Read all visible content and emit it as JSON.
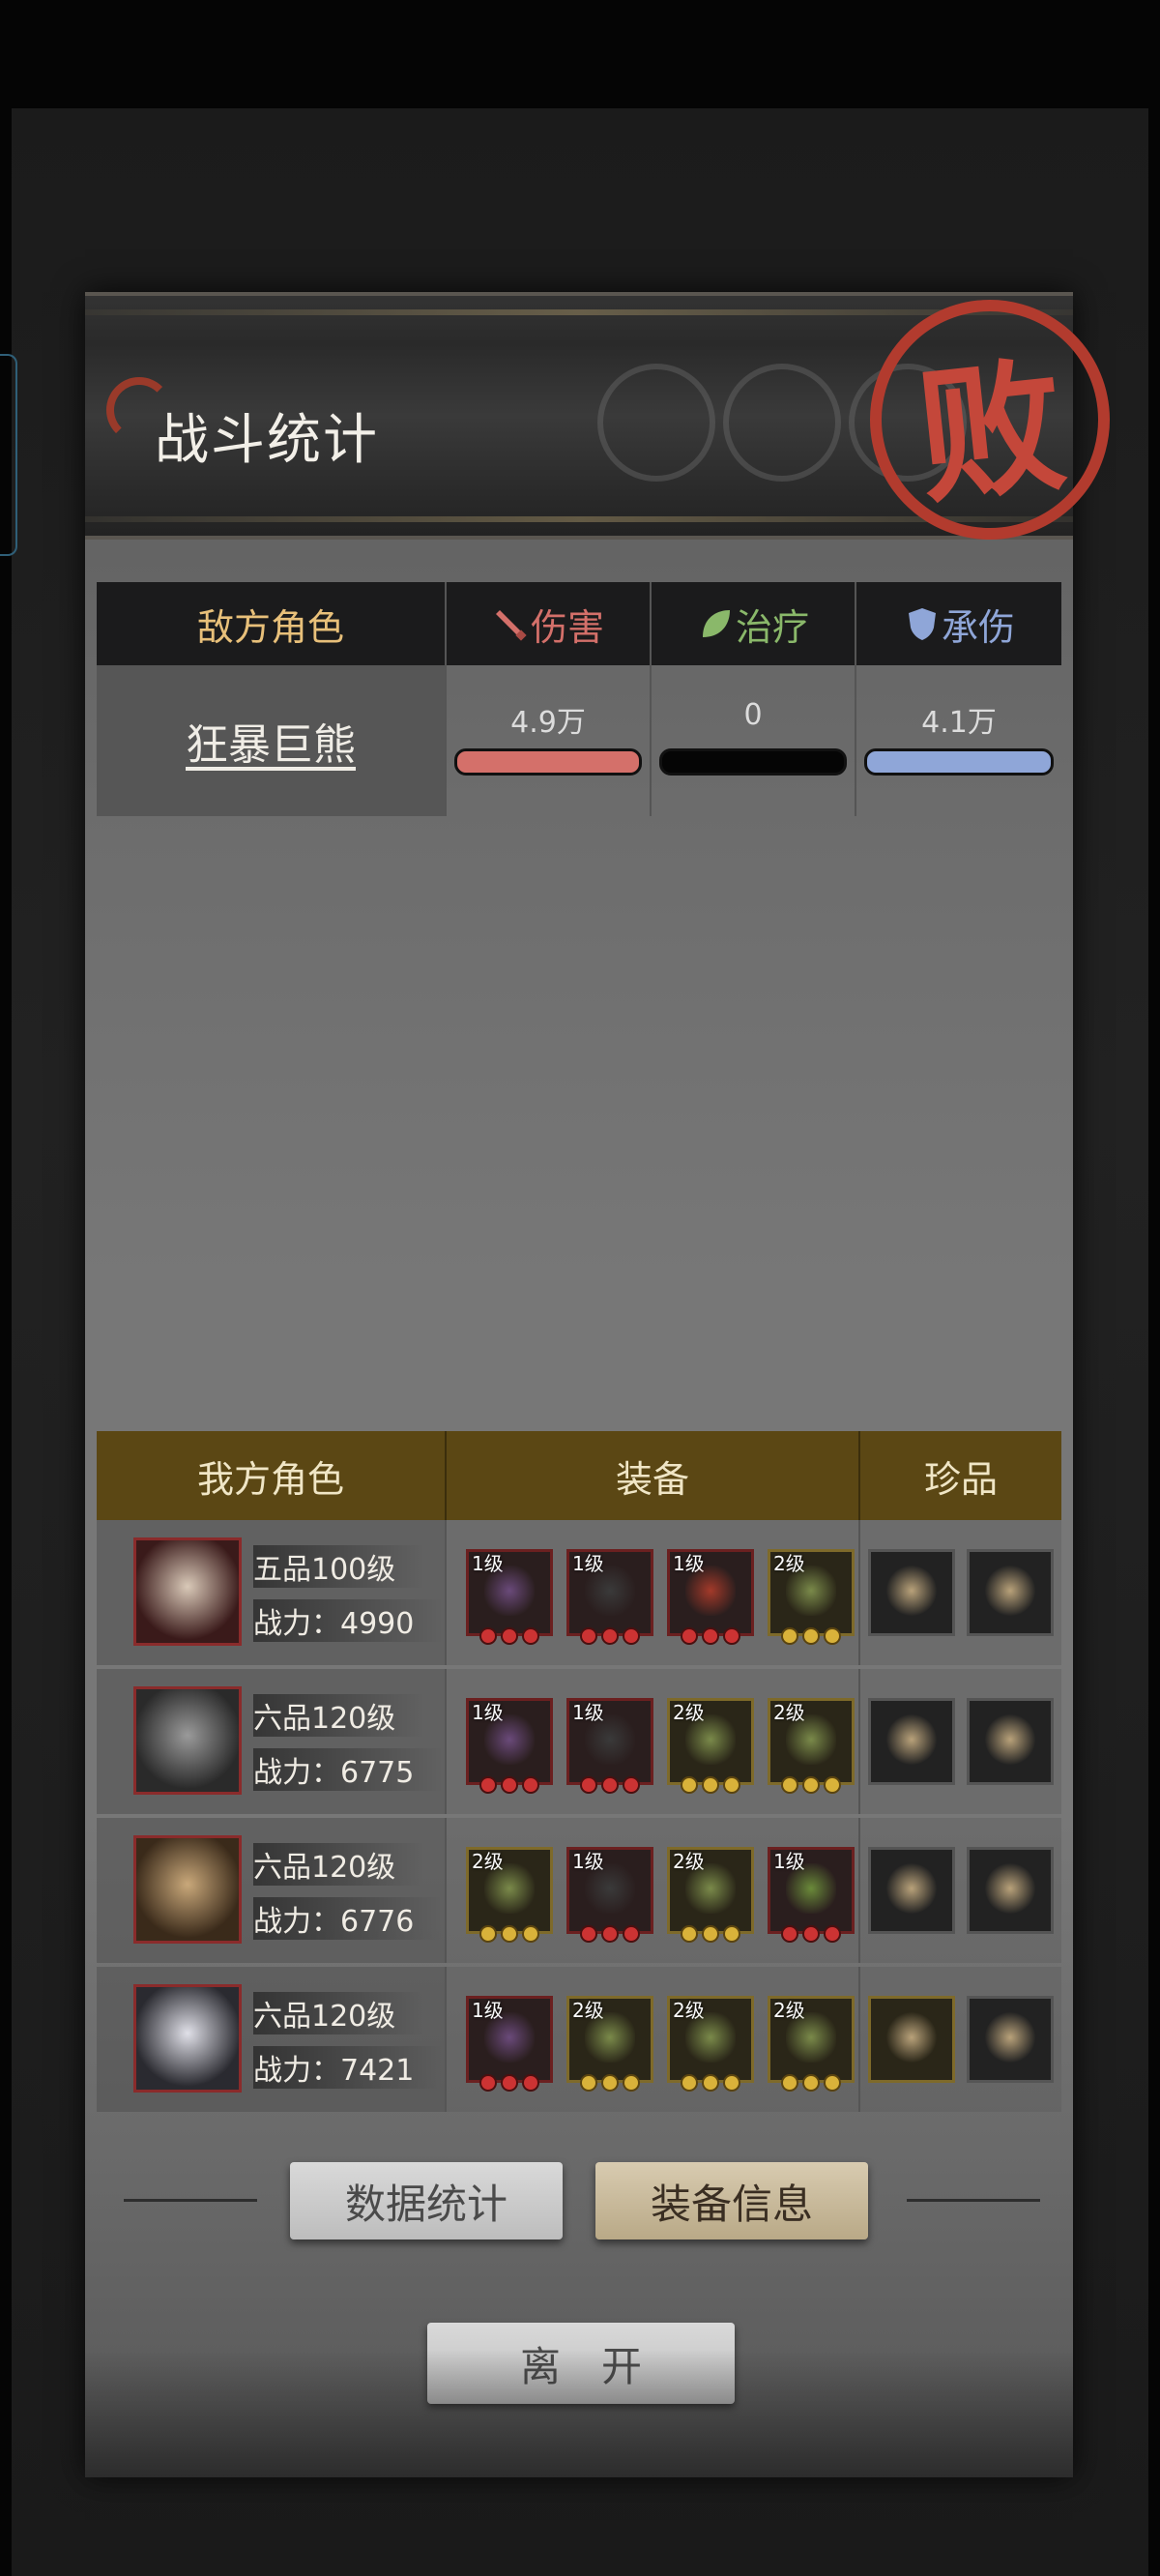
{
  "header": {
    "title": "战斗统计",
    "seal_text": "败"
  },
  "enemy_table": {
    "headers": {
      "role": "敌方角色",
      "damage": "伤害",
      "healing": "治疗",
      "tanking": "承伤"
    },
    "rows": [
      {
        "name": "狂暴巨熊",
        "damage": "4.9万",
        "healing": "0",
        "tanking": "4.1万",
        "damage_fill": 1.0,
        "healing_fill": 0.0,
        "tanking_fill": 1.0
      }
    ]
  },
  "ally_table": {
    "headers": {
      "role": "我方角色",
      "equipment": "装备",
      "treasure": "珍品"
    },
    "rows": [
      {
        "rank": "五品100级",
        "power_label": "战力：",
        "power": "4990",
        "equipment": [
          {
            "level": "1级"
          },
          {
            "level": "1级"
          },
          {
            "level": "1级"
          },
          {
            "level": "2级"
          }
        ]
      },
      {
        "rank": "六品120级",
        "power_label": "战力：",
        "power": "6775",
        "equipment": [
          {
            "level": "1级"
          },
          {
            "level": "1级"
          },
          {
            "level": "2级"
          },
          {
            "level": "2级"
          }
        ]
      },
      {
        "rank": "六品120级",
        "power_label": "战力：",
        "power": "6776",
        "equipment": [
          {
            "level": "2级"
          },
          {
            "level": "1级"
          },
          {
            "level": "2级"
          },
          {
            "level": "1级"
          }
        ]
      },
      {
        "rank": "六品120级",
        "power_label": "战力：",
        "power": "7421",
        "equipment": [
          {
            "level": "1级"
          },
          {
            "level": "2级"
          },
          {
            "level": "2级"
          },
          {
            "level": "2级"
          }
        ]
      }
    ]
  },
  "buttons": {
    "stats": "数据统计",
    "equipment_info": "装备信息",
    "leave": "离　开"
  },
  "colors": {
    "damage": "#d4706a",
    "healing": "#8ab86a",
    "tanking": "#8fa6d8",
    "ally_header": "#5b4714",
    "seal": "#b23b2e"
  }
}
